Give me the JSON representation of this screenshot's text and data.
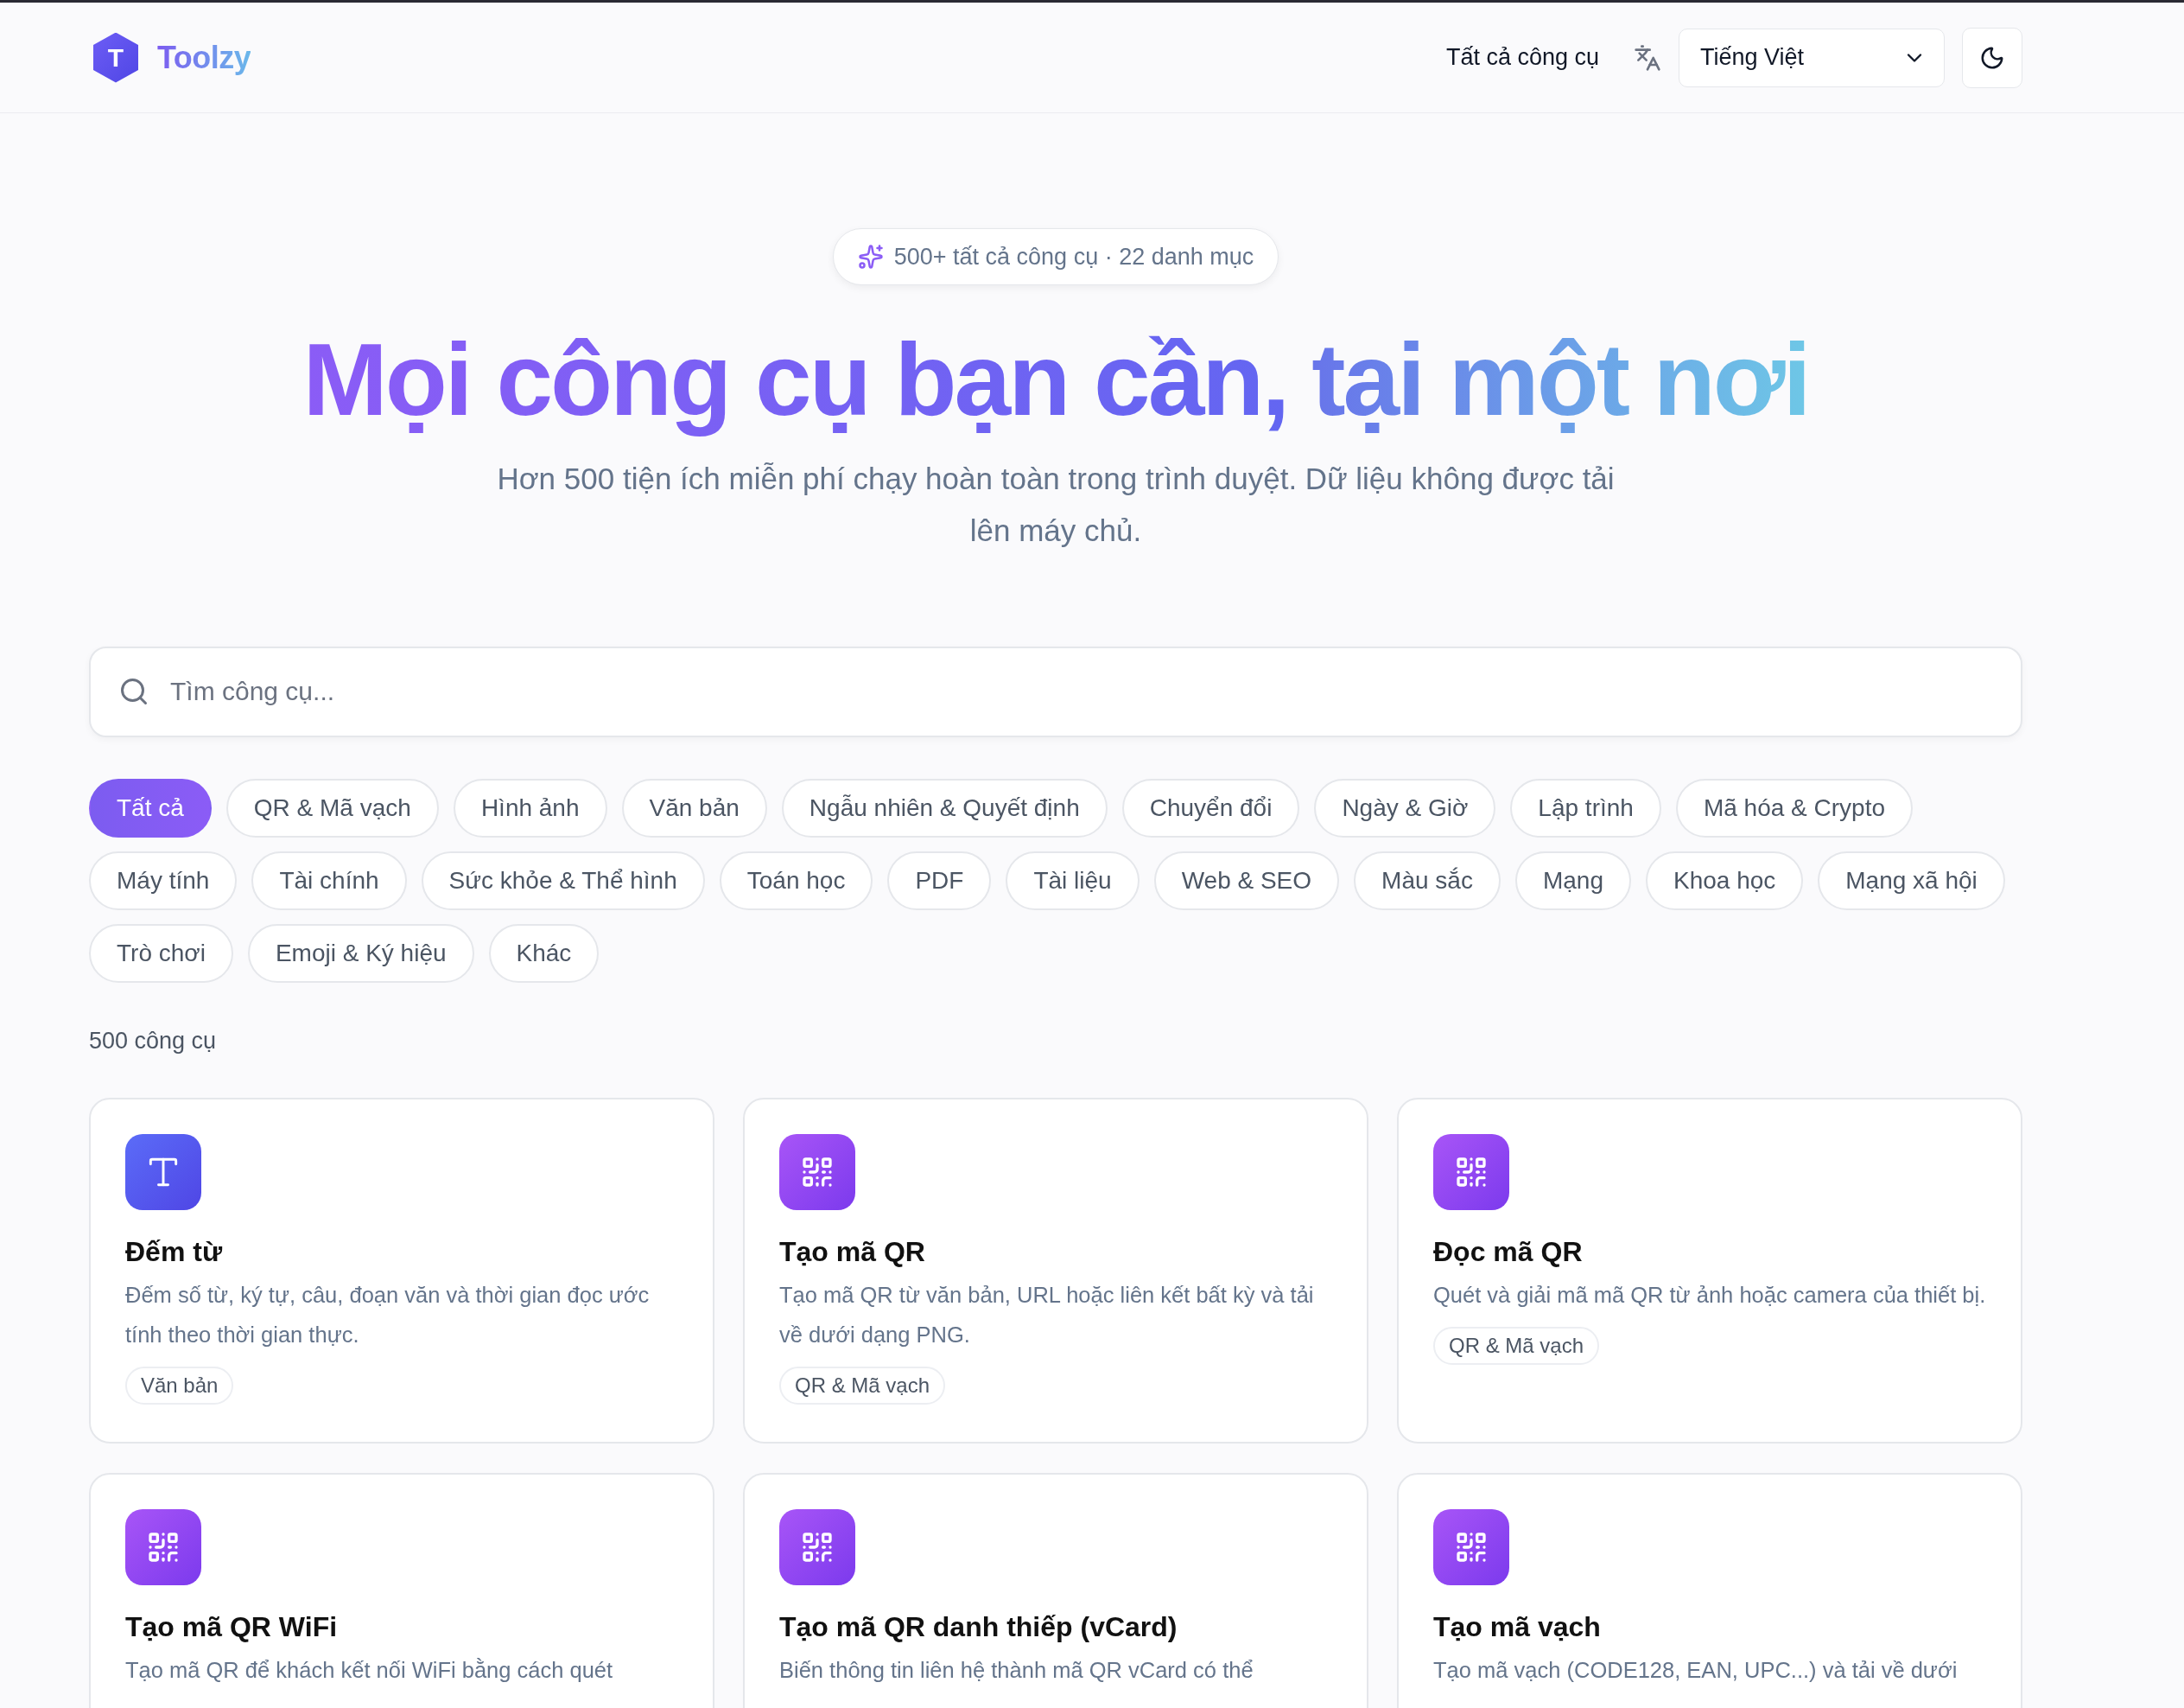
{
  "header": {
    "logo_mark": "T",
    "brand": "Toolzy",
    "nav_link": "Tất cả công cụ",
    "language": "Tiếng Việt"
  },
  "hero": {
    "badge": "500+ tất cả công cụ · 22 danh mục",
    "title_start": "Mọi công cụ bạn cần,",
    "title_end": "tại một nơi",
    "subtitle": "Hơn 500 tiện ích miễn phí chạy hoàn toàn trong trình duyệt. Dữ liệu không được tải lên máy chủ."
  },
  "search": {
    "placeholder": "Tìm công cụ..."
  },
  "categories": [
    {
      "label": "Tất cả",
      "selected": true
    },
    {
      "label": "QR & Mã vạch",
      "selected": false
    },
    {
      "label": "Hình ảnh",
      "selected": false
    },
    {
      "label": "Văn bản",
      "selected": false
    },
    {
      "label": "Ngẫu nhiên & Quyết định",
      "selected": false
    },
    {
      "label": "Chuyển đổi",
      "selected": false
    },
    {
      "label": "Ngày & Giờ",
      "selected": false
    },
    {
      "label": "Lập trình",
      "selected": false
    },
    {
      "label": "Mã hóa & Crypto",
      "selected": false
    },
    {
      "label": "Máy tính",
      "selected": false
    },
    {
      "label": "Tài chính",
      "selected": false
    },
    {
      "label": "Sức khỏe & Thể hình",
      "selected": false
    },
    {
      "label": "Toán học",
      "selected": false
    },
    {
      "label": "PDF",
      "selected": false
    },
    {
      "label": "Tài liệu",
      "selected": false
    },
    {
      "label": "Web & SEO",
      "selected": false
    },
    {
      "label": "Màu sắc",
      "selected": false
    },
    {
      "label": "Mạng",
      "selected": false
    },
    {
      "label": "Khoa học",
      "selected": false
    },
    {
      "label": "Mạng xã hội",
      "selected": false
    },
    {
      "label": "Trò chơi",
      "selected": false
    },
    {
      "label": "Emoji & Ký hiệu",
      "selected": false
    },
    {
      "label": "Khác",
      "selected": false
    }
  ],
  "count": "500 công cụ",
  "tools": [
    {
      "kind": "text",
      "title": "Đếm từ",
      "description": "Đếm số từ, ký tự, câu, đoạn văn và thời gian đọc ước tính theo thời gian thực.",
      "tag": "Văn bản"
    },
    {
      "kind": "qr",
      "title": "Tạo mã QR",
      "description": "Tạo mã QR từ văn bản, URL hoặc liên kết bất kỳ và tải về dưới dạng PNG.",
      "tag": "QR & Mã vạch"
    },
    {
      "kind": "qr",
      "title": "Đọc mã QR",
      "description": "Quét và giải mã mã QR từ ảnh hoặc camera của thiết bị.",
      "tag": "QR & Mã vạch"
    },
    {
      "kind": "qr",
      "title": "Tạo mã QR WiFi",
      "description": "Tạo mã QR để khách kết nối WiFi bằng cách quét"
    },
    {
      "kind": "qr",
      "title": "Tạo mã QR danh thiếp (vCard)",
      "description": "Biến thông tin liên hệ thành mã QR vCard có thể"
    },
    {
      "kind": "qr",
      "title": "Tạo mã vạch",
      "description": "Tạo mã vạch (CODE128, EAN, UPC...) và tải về dưới"
    }
  ]
}
